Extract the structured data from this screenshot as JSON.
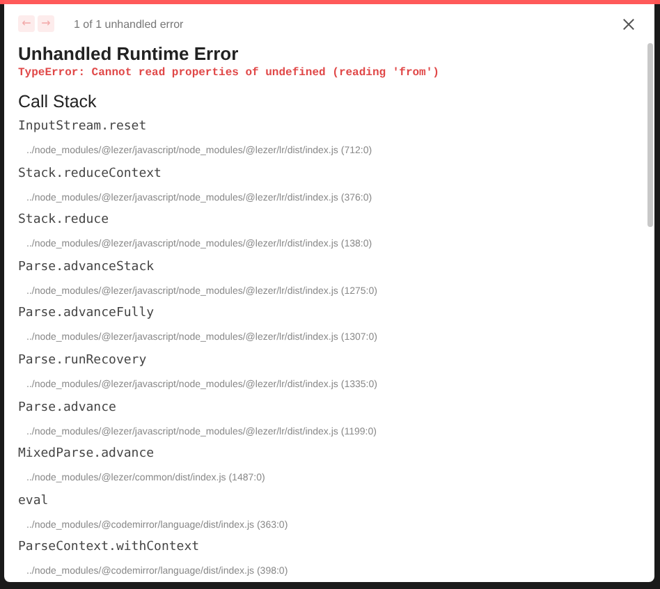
{
  "nav": {
    "buttons": [
      {
        "icon": "←",
        "disabled": true
      },
      {
        "icon": "→",
        "disabled": true
      }
    ],
    "counter": "1 of 1 unhandled error"
  },
  "title": "Unhandled Runtime Error",
  "error_message": "TypeError: Cannot read properties of undefined (reading 'from')",
  "section_heading": "Call Stack",
  "frames": [
    {
      "function": "InputStream.reset",
      "location": "../node_modules/@lezer/javascript/node_modules/@lezer/lr/dist/index.js (712:0)"
    },
    {
      "function": "Stack.reduceContext",
      "location": "../node_modules/@lezer/javascript/node_modules/@lezer/lr/dist/index.js (376:0)"
    },
    {
      "function": "Stack.reduce",
      "location": "../node_modules/@lezer/javascript/node_modules/@lezer/lr/dist/index.js (138:0)"
    },
    {
      "function": "Parse.advanceStack",
      "location": "../node_modules/@lezer/javascript/node_modules/@lezer/lr/dist/index.js (1275:0)"
    },
    {
      "function": "Parse.advanceFully",
      "location": "../node_modules/@lezer/javascript/node_modules/@lezer/lr/dist/index.js (1307:0)"
    },
    {
      "function": "Parse.runRecovery",
      "location": "../node_modules/@lezer/javascript/node_modules/@lezer/lr/dist/index.js (1335:0)"
    },
    {
      "function": "Parse.advance",
      "location": "../node_modules/@lezer/javascript/node_modules/@lezer/lr/dist/index.js (1199:0)"
    },
    {
      "function": "MixedParse.advance",
      "location": "../node_modules/@lezer/common/dist/index.js (1487:0)"
    },
    {
      "function": "eval",
      "location": "../node_modules/@codemirror/language/dist/index.js (363:0)"
    },
    {
      "function": "ParseContext.withContext",
      "location": "../node_modules/@codemirror/language/dist/index.js (398:0)"
    }
  ]
}
